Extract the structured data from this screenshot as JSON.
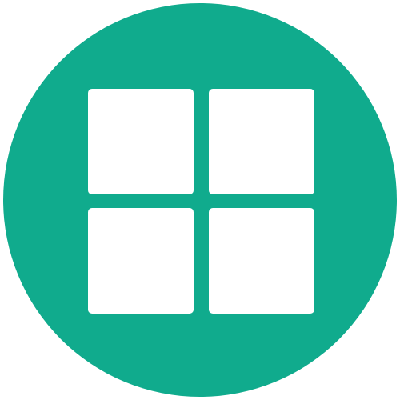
{
  "icon": {
    "name": "grid-icon",
    "background_color": "#10ab8d",
    "tile_color": "#ffffff",
    "tiles": [
      "top-left",
      "top-right",
      "bottom-left",
      "bottom-right"
    ]
  }
}
